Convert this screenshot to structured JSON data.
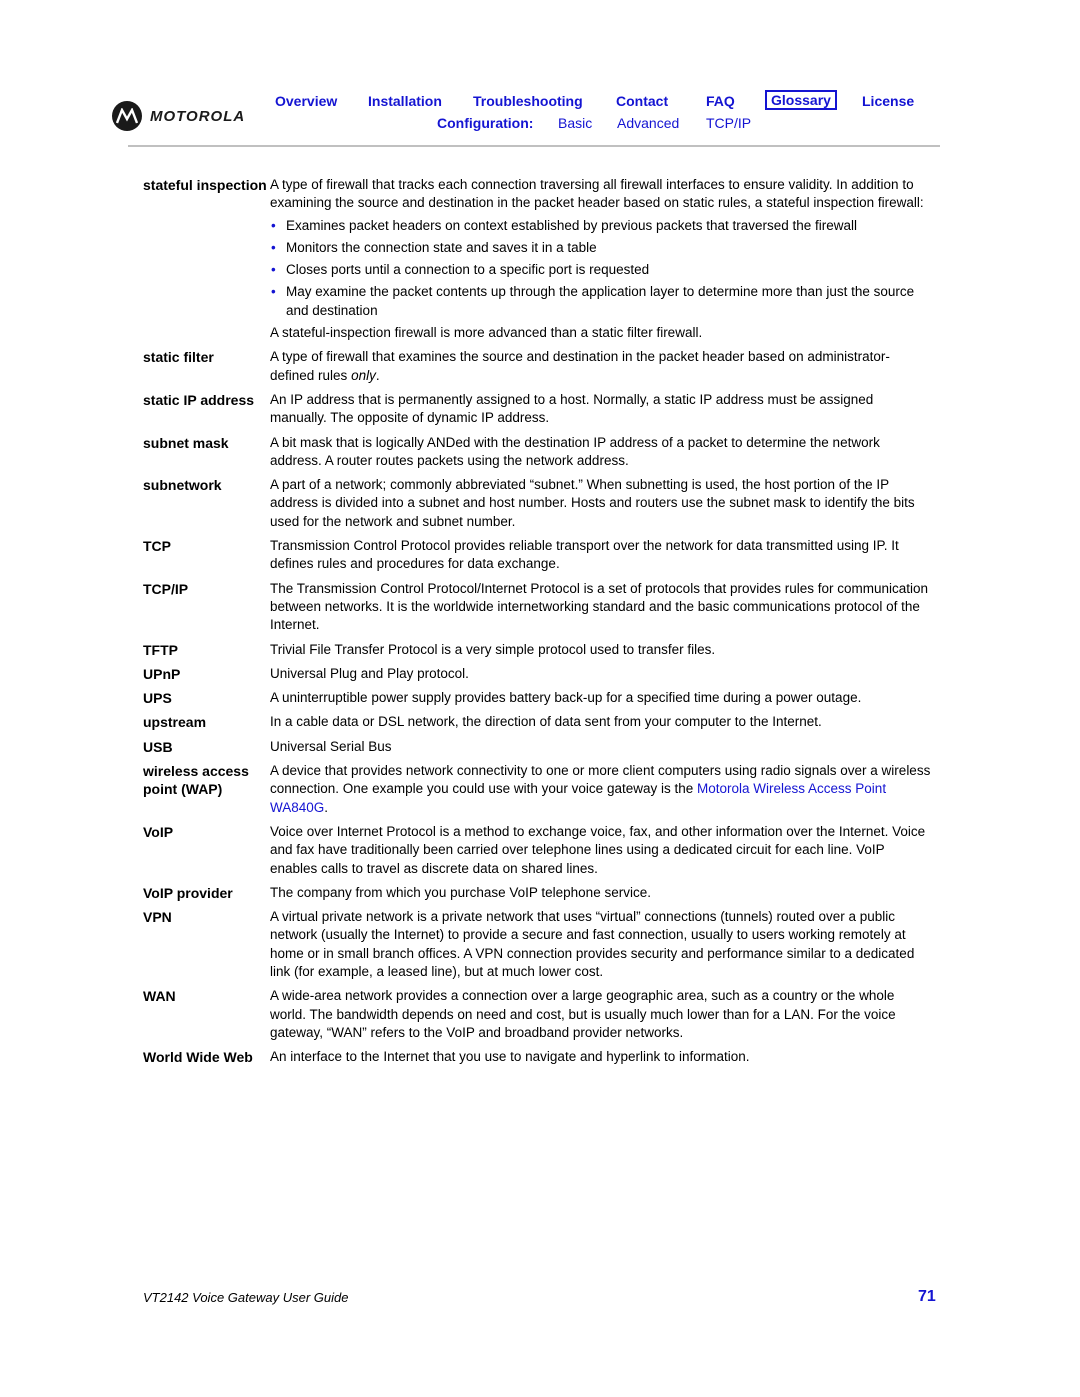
{
  "brand": {
    "name": "MOTOROLA",
    "logo_icon": "motorola-batwing-icon"
  },
  "nav": {
    "top": [
      {
        "label": "Overview",
        "current": false
      },
      {
        "label": "Installation",
        "current": false
      },
      {
        "label": "Troubleshooting",
        "current": false
      },
      {
        "label": "Contact",
        "current": false
      },
      {
        "label": "FAQ",
        "current": false
      },
      {
        "label": "Glossary",
        "current": true
      },
      {
        "label": "License",
        "current": false
      }
    ],
    "config_label": "Configuration:",
    "config_links": [
      "Basic",
      "Advanced",
      "TCP/IP"
    ]
  },
  "glossary": {
    "stateful": {
      "term": "stateful inspection",
      "intro": "A type of firewall that tracks each connection traversing all firewall interfaces to ensure validity. In addition to examining the source and destination in the packet header based on static rules, a stateful inspection firewall:",
      "bullets": [
        "Examines packet headers on context established by previous packets that traversed the firewall",
        "Monitors the connection state and saves it in a table",
        "Closes ports until a connection to a specific port is requested",
        "May examine the packet contents up through the application layer to determine more than just the source and destination"
      ],
      "outro": "A stateful-inspection firewall is more advanced than a static filter firewall."
    },
    "static_filter": {
      "term": "static filter",
      "text": "A type of firewall that examines the source and destination in the packet header based on administrator-defined rules ",
      "emph": "only",
      "tail": "."
    },
    "static_ip": {
      "term": "static IP address",
      "text": "An IP address that is permanently assigned to a host. Normally, a static IP address must be assigned manually. The opposite of dynamic IP address."
    },
    "subnet_mask": {
      "term": "subnet mask",
      "text": "A bit mask that is logically ANDed with the destination IP address of a packet to determine the network address. A router routes packets using the network address."
    },
    "subnetwork": {
      "term": "subnetwork",
      "text": "A part of a network; commonly abbreviated “subnet.” When subnetting is used, the host portion of the IP address is divided into a subnet and host number. Hosts and routers use the subnet mask to identify the bits used for the network and subnet number."
    },
    "tcp": {
      "term": "TCP",
      "text": "Transmission Control Protocol provides reliable transport over the network for data transmitted using IP. It defines rules and procedures for data exchange."
    },
    "tcpip": {
      "term": "TCP/IP",
      "text": "The Transmission Control Protocol/Internet Protocol is a set of protocols that provides rules for communication between networks. It is the worldwide internetworking standard and the basic communications protocol of the Internet."
    },
    "tftp": {
      "term": "TFTP",
      "text": "Trivial File Transfer Protocol is a very simple protocol used to transfer files."
    },
    "upnp": {
      "term": "UPnP",
      "text": "Universal Plug and Play protocol."
    },
    "ups": {
      "term": "UPS",
      "text": "A uninterruptible power supply provides battery back-up for a specified time during a power outage."
    },
    "upstream": {
      "term": "upstream",
      "text": "In a cable data or DSL network, the direction of data sent from your computer to the Internet."
    },
    "usb": {
      "term": "USB",
      "text": "Universal Serial Bus"
    },
    "wap": {
      "term": "wireless access point (WAP)",
      "text": "A device that provides network connectivity to one or more client computers using radio signals over a wireless connection. One example you could use with your voice gateway is the ",
      "link": "Motorola Wireless Access Point WA840G",
      "tail": "."
    },
    "voip": {
      "term": "VoIP",
      "text": "Voice over Internet Protocol is a method to exchange voice, fax, and other information over the Internet. Voice and fax have traditionally been carried over telephone lines using a dedicated circuit for each line. VoIP enables calls to travel as discrete data on shared lines."
    },
    "voip_provider": {
      "term": "VoIP provider",
      "text": "The company from which you purchase VoIP telephone service."
    },
    "vpn": {
      "term": "VPN",
      "text": "A virtual private network is a private network that uses “virtual” connections (tunnels) routed over a public network (usually the Internet) to provide a secure and fast connection, usually to users working remotely at home or in small branch offices. A VPN connection provides security and performance similar to a dedicated link (for example, a leased line), but at much lower cost."
    },
    "wan": {
      "term": "WAN",
      "text": "A wide-area network provides a connection over a large geographic area, such as a country or the whole world. The bandwidth depends on need and cost, but is usually much lower than for a LAN. For the voice gateway, “WAN” refers to the VoIP and broadband provider networks."
    },
    "www": {
      "term": "World Wide Web",
      "text": "An interface to the Internet that you use to navigate and hyperlink to information."
    }
  },
  "footer": {
    "title": "VT2142 Voice Gateway User Guide",
    "page_number": "71"
  },
  "colors": {
    "link": "#1414d2",
    "rule": "#c0c0c0",
    "text": "#000000"
  }
}
